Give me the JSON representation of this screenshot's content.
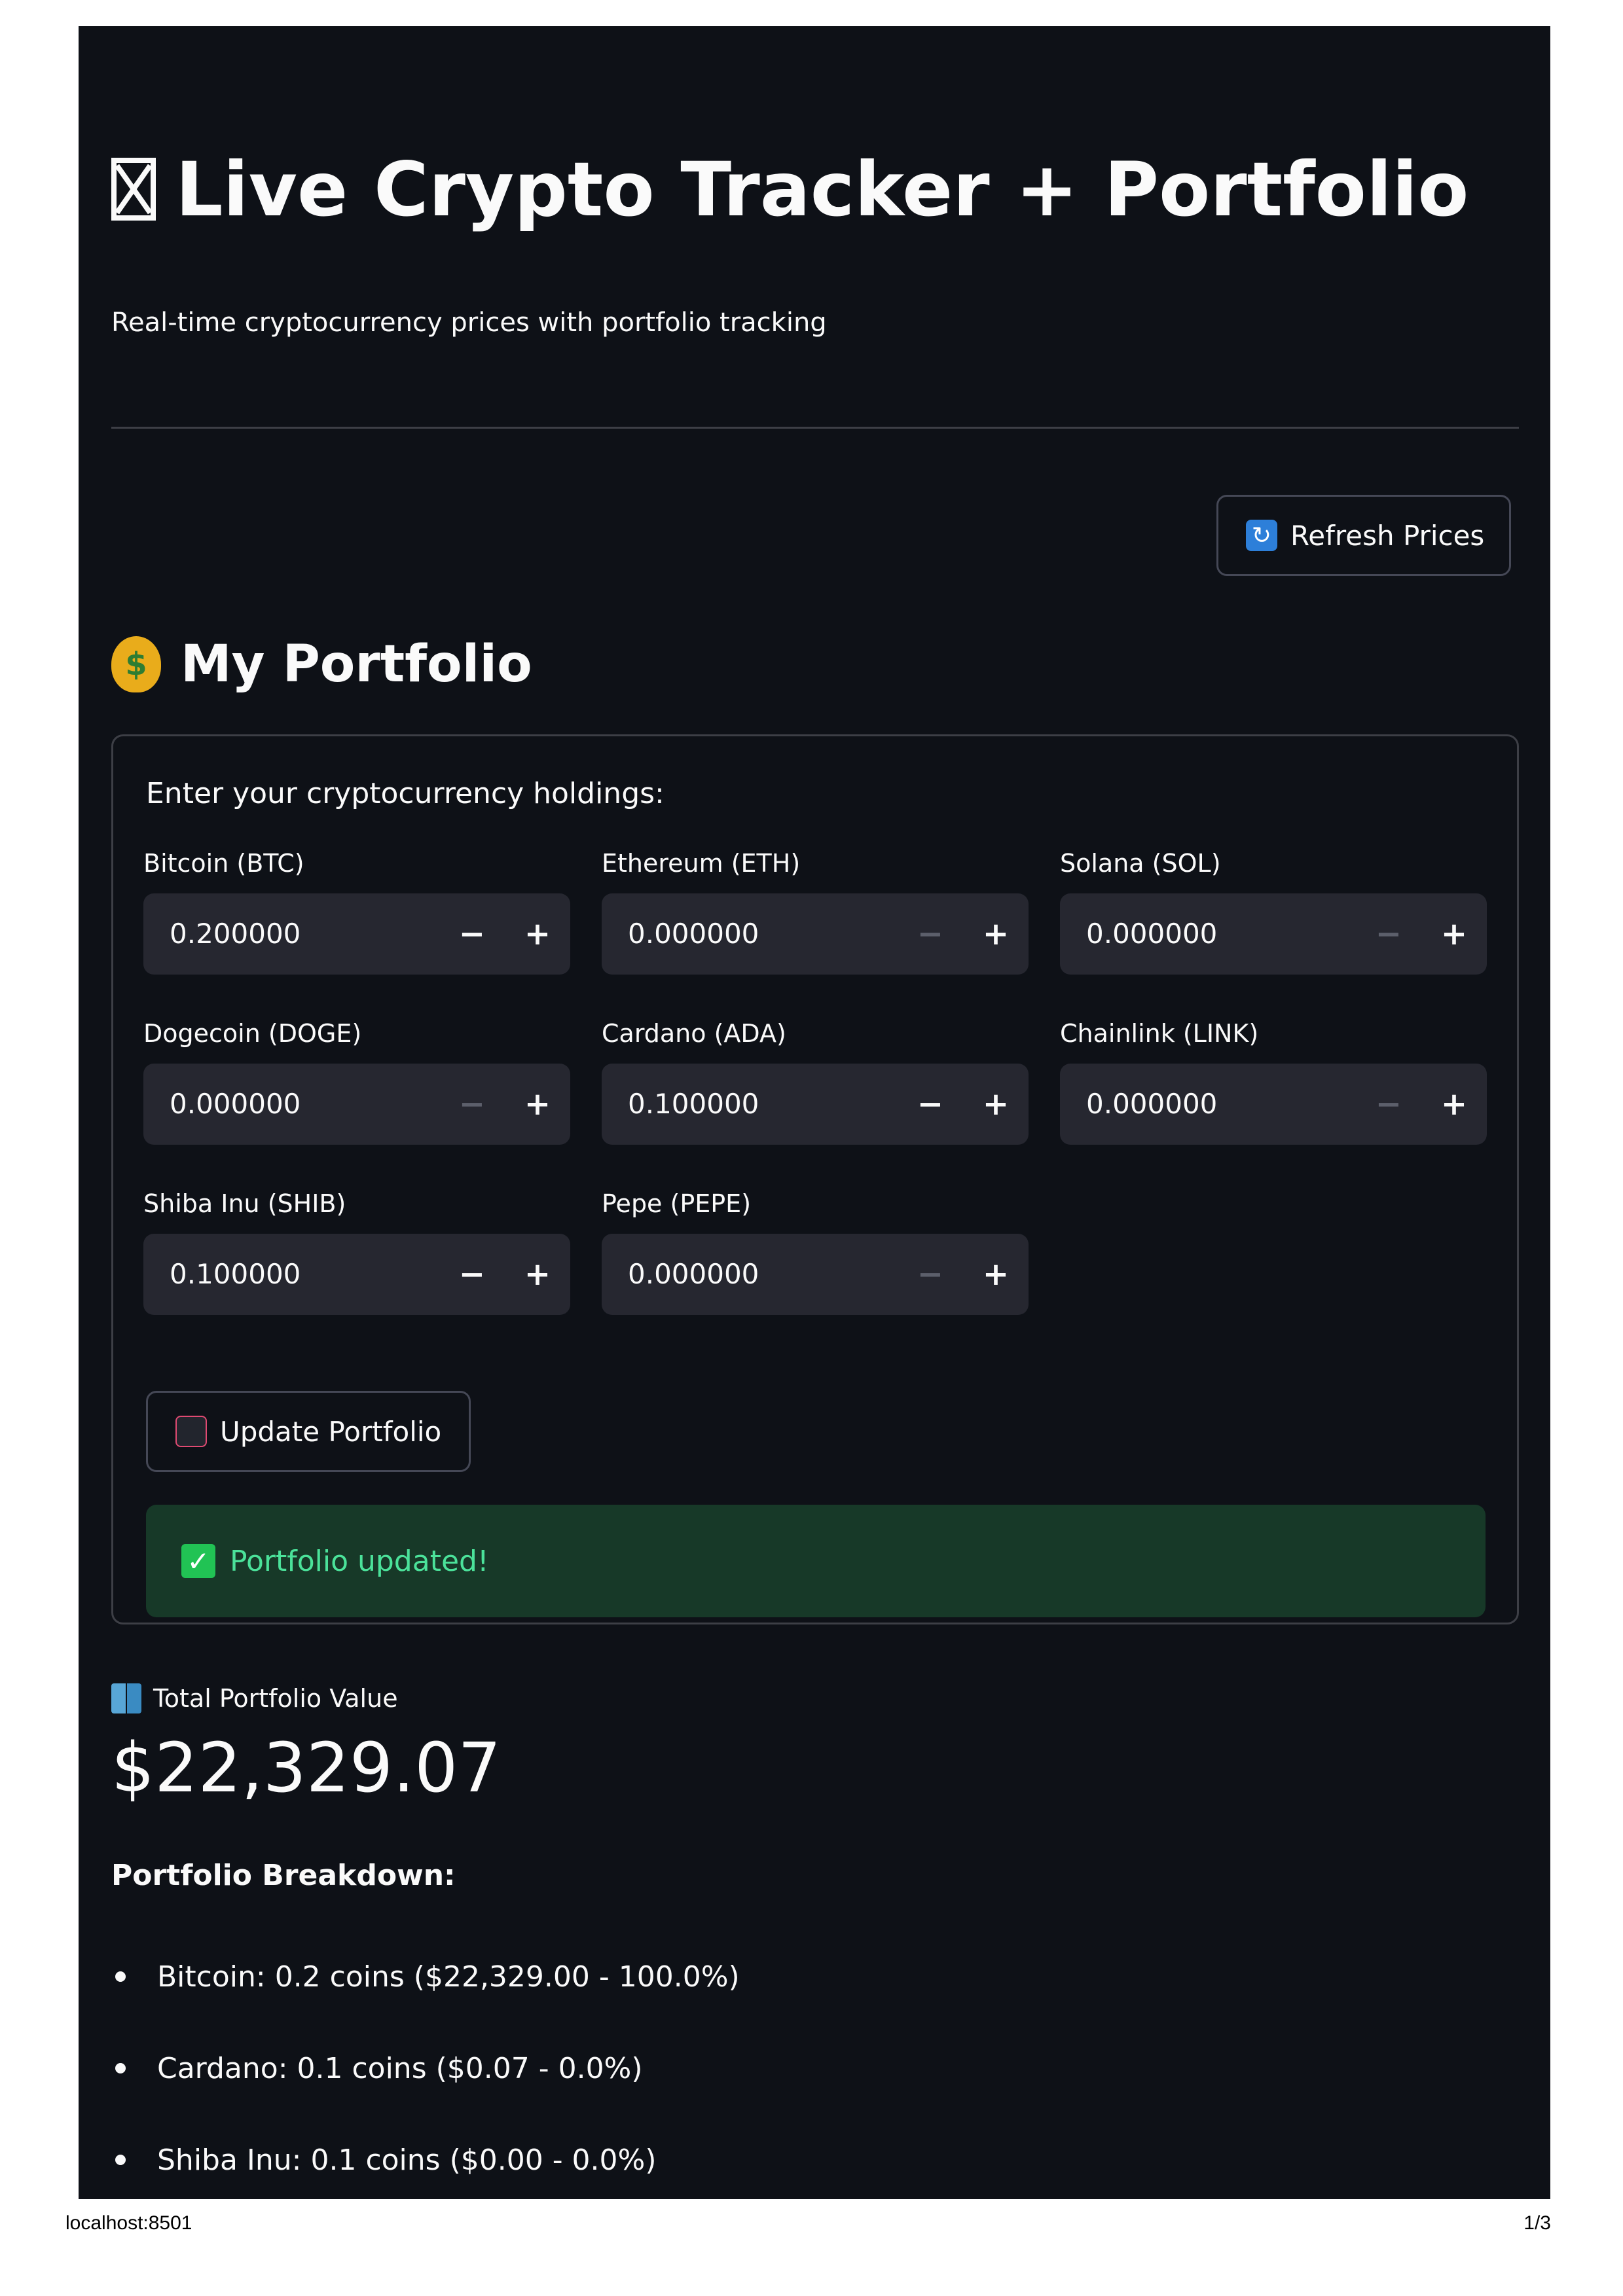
{
  "header": {
    "title": "Live Crypto Tracker + Portfolio",
    "subtitle": "Real-time cryptocurrency prices with portfolio tracking"
  },
  "actions": {
    "refresh_label": "Refresh Prices",
    "refresh_icon": "refresh-icon"
  },
  "portfolio": {
    "heading": "My Portfolio",
    "heading_icon": "money-bag-icon",
    "form_lead": "Enter your cryptocurrency holdings:",
    "fields": [
      {
        "label": "Bitcoin (BTC)",
        "value": "0.200000",
        "minus_enabled": true
      },
      {
        "label": "Ethereum (ETH)",
        "value": "0.000000",
        "minus_enabled": false
      },
      {
        "label": "Solana (SOL)",
        "value": "0.000000",
        "minus_enabled": false
      },
      {
        "label": "Dogecoin (DOGE)",
        "value": "0.000000",
        "minus_enabled": false
      },
      {
        "label": "Cardano (ADA)",
        "value": "0.100000",
        "minus_enabled": true
      },
      {
        "label": "Chainlink (LINK)",
        "value": "0.000000",
        "minus_enabled": false
      },
      {
        "label": "Shiba Inu (SHIB)",
        "value": "0.100000",
        "minus_enabled": true
      },
      {
        "label": "Pepe (PEPE)",
        "value": "0.000000",
        "minus_enabled": false
      }
    ],
    "update_label": "Update Portfolio",
    "update_icon": "floppy-disk-icon",
    "success_message": "Portfolio updated!"
  },
  "metric": {
    "label": "Total Portfolio Value",
    "value": "$22,329.07"
  },
  "breakdown": {
    "title": "Portfolio Breakdown:",
    "items": [
      "Bitcoin: 0.2 coins ($22,329.00 - 100.0%)",
      "Cardano: 0.1 coins ($0.07 - 0.0%)",
      "Shiba Inu: 0.1 coins ($0.00 - 0.0%)"
    ]
  },
  "footer": {
    "url": "localhost:8501",
    "page": "1/3"
  },
  "colors": {
    "background": "#0e1117",
    "input": "#262730",
    "success_bg": "#173928",
    "success_text": "#4be29a"
  }
}
